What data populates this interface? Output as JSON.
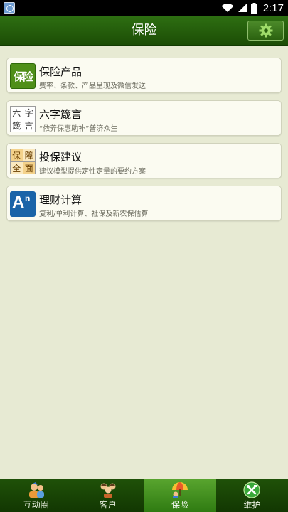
{
  "status_bar": {
    "time": "2:17"
  },
  "header": {
    "title": "保险"
  },
  "menu": [
    {
      "title": "保险产品",
      "subtitle": "费率、条款、产品呈现及微信发送",
      "icon": "baoxian-icon",
      "icon_chars": [
        "保",
        "险"
      ]
    },
    {
      "title": "六字箴言",
      "subtitle": "“依养保惠助补”普济众生",
      "icon": "liuzi-icon",
      "icon_chars": [
        "六",
        "字",
        "箴",
        "言"
      ]
    },
    {
      "title": "投保建议",
      "subtitle": "建议模型提供定性定量的要约方案",
      "icon": "baozhang-icon",
      "icon_chars": [
        "保",
        "障",
        "全",
        "面"
      ]
    },
    {
      "title": "理财计算",
      "subtitle": "复利/单利计算、社保及新农保估算",
      "icon": "licai-icon",
      "icon_chars": [
        "A",
        "n"
      ]
    }
  ],
  "tabs": [
    {
      "label": "互动圈",
      "icon": "people-icon",
      "active": false
    },
    {
      "label": "客户",
      "icon": "customers-icon",
      "active": false
    },
    {
      "label": "保险",
      "icon": "umbrella-icon",
      "active": true
    },
    {
      "label": "维护",
      "icon": "tools-icon",
      "active": false
    }
  ],
  "colors": {
    "header": "#1c4d06",
    "background": "#e7ead3",
    "tab_active": "#58a42e"
  }
}
